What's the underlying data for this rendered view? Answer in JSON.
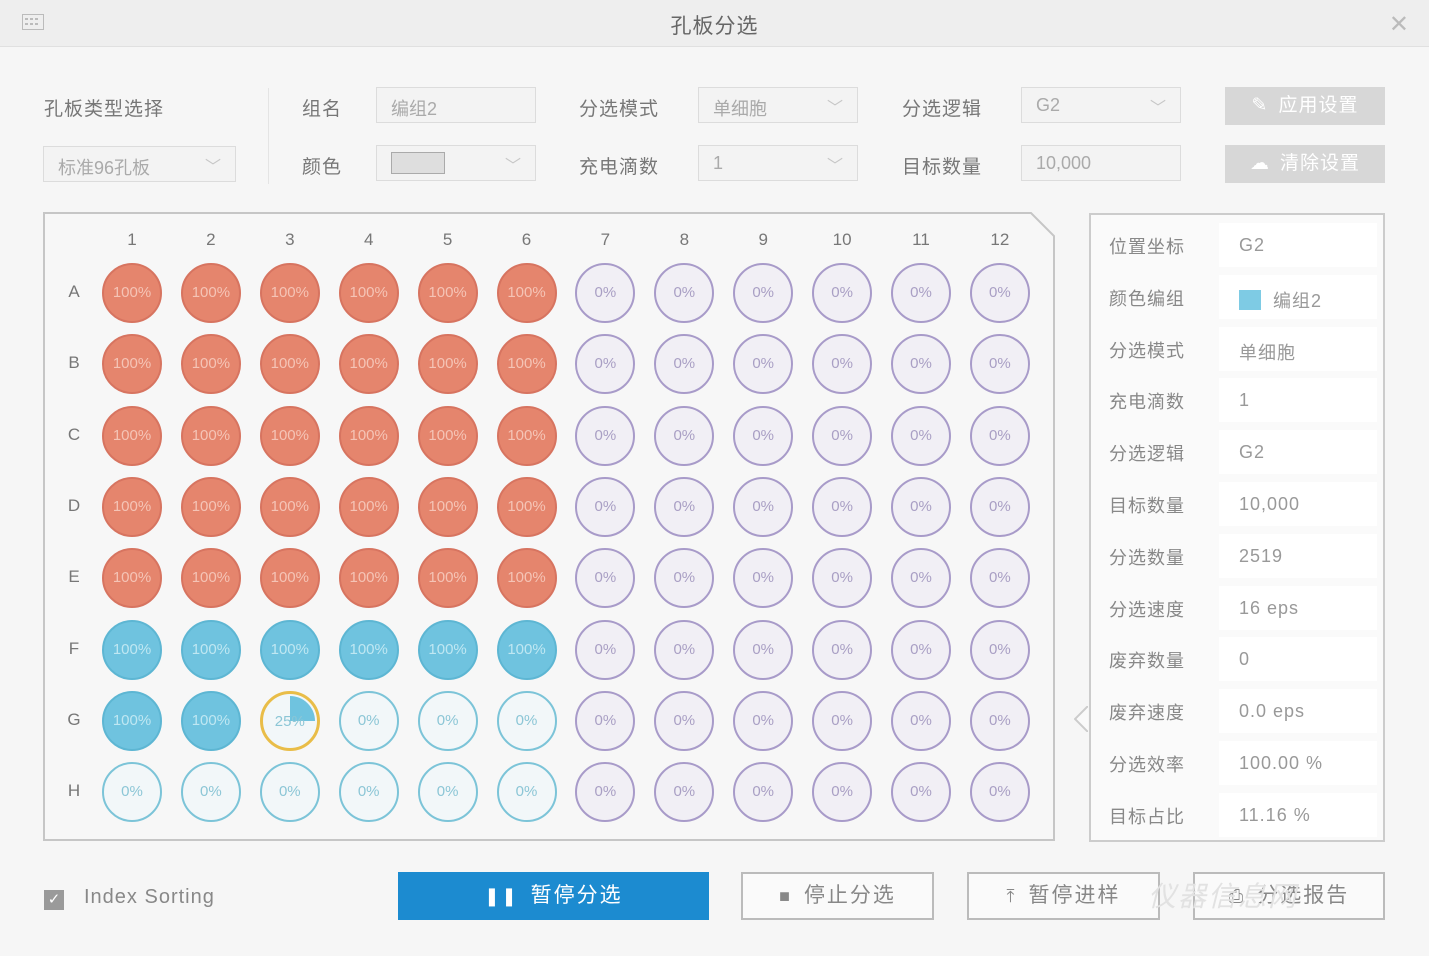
{
  "window": {
    "title": "孔板分选"
  },
  "settings": {
    "plate_type": {
      "label": "孔板类型选择",
      "value": "标准96孔板"
    },
    "group_name": {
      "label": "组名",
      "value": "编组2"
    },
    "color": {
      "label": "颜色"
    },
    "sort_mode": {
      "label": "分选模式",
      "value": "单细胞"
    },
    "charge_drops": {
      "label": "充电滴数",
      "value": "1"
    },
    "sort_logic": {
      "label": "分选逻辑",
      "value": "G2"
    },
    "target_count": {
      "label": "目标数量",
      "value": "10,000"
    },
    "apply_button": "应用设置",
    "clear_button": "清除设置"
  },
  "plate": {
    "columns": [
      "1",
      "2",
      "3",
      "4",
      "5",
      "6",
      "7",
      "8",
      "9",
      "10",
      "11",
      "12"
    ],
    "rows": [
      {
        "label": "A",
        "wells": [
          {
            "text": "100%",
            "state": "red"
          },
          {
            "text": "100%",
            "state": "red"
          },
          {
            "text": "100%",
            "state": "red"
          },
          {
            "text": "100%",
            "state": "red"
          },
          {
            "text": "100%",
            "state": "red"
          },
          {
            "text": "100%",
            "state": "red"
          },
          {
            "text": "0%",
            "state": "empty-p"
          },
          {
            "text": "0%",
            "state": "empty-p"
          },
          {
            "text": "0%",
            "state": "empty-p"
          },
          {
            "text": "0%",
            "state": "empty-p"
          },
          {
            "text": "0%",
            "state": "empty-p"
          },
          {
            "text": "0%",
            "state": "empty-p"
          }
        ]
      },
      {
        "label": "B",
        "wells": [
          {
            "text": "100%",
            "state": "red"
          },
          {
            "text": "100%",
            "state": "red"
          },
          {
            "text": "100%",
            "state": "red"
          },
          {
            "text": "100%",
            "state": "red"
          },
          {
            "text": "100%",
            "state": "red"
          },
          {
            "text": "100%",
            "state": "red"
          },
          {
            "text": "0%",
            "state": "empty-p"
          },
          {
            "text": "0%",
            "state": "empty-p"
          },
          {
            "text": "0%",
            "state": "empty-p"
          },
          {
            "text": "0%",
            "state": "empty-p"
          },
          {
            "text": "0%",
            "state": "empty-p"
          },
          {
            "text": "0%",
            "state": "empty-p"
          }
        ]
      },
      {
        "label": "C",
        "wells": [
          {
            "text": "100%",
            "state": "red"
          },
          {
            "text": "100%",
            "state": "red"
          },
          {
            "text": "100%",
            "state": "red"
          },
          {
            "text": "100%",
            "state": "red"
          },
          {
            "text": "100%",
            "state": "red"
          },
          {
            "text": "100%",
            "state": "red"
          },
          {
            "text": "0%",
            "state": "empty-p"
          },
          {
            "text": "0%",
            "state": "empty-p"
          },
          {
            "text": "0%",
            "state": "empty-p"
          },
          {
            "text": "0%",
            "state": "empty-p"
          },
          {
            "text": "0%",
            "state": "empty-p"
          },
          {
            "text": "0%",
            "state": "empty-p"
          }
        ]
      },
      {
        "label": "D",
        "wells": [
          {
            "text": "100%",
            "state": "red"
          },
          {
            "text": "100%",
            "state": "red"
          },
          {
            "text": "100%",
            "state": "red"
          },
          {
            "text": "100%",
            "state": "red"
          },
          {
            "text": "100%",
            "state": "red"
          },
          {
            "text": "100%",
            "state": "red"
          },
          {
            "text": "0%",
            "state": "empty-p"
          },
          {
            "text": "0%",
            "state": "empty-p"
          },
          {
            "text": "0%",
            "state": "empty-p"
          },
          {
            "text": "0%",
            "state": "empty-p"
          },
          {
            "text": "0%",
            "state": "empty-p"
          },
          {
            "text": "0%",
            "state": "empty-p"
          }
        ]
      },
      {
        "label": "E",
        "wells": [
          {
            "text": "100%",
            "state": "red"
          },
          {
            "text": "100%",
            "state": "red"
          },
          {
            "text": "100%",
            "state": "red"
          },
          {
            "text": "100%",
            "state": "red"
          },
          {
            "text": "100%",
            "state": "red"
          },
          {
            "text": "100%",
            "state": "red"
          },
          {
            "text": "0%",
            "state": "empty-p"
          },
          {
            "text": "0%",
            "state": "empty-p"
          },
          {
            "text": "0%",
            "state": "empty-p"
          },
          {
            "text": "0%",
            "state": "empty-p"
          },
          {
            "text": "0%",
            "state": "empty-p"
          },
          {
            "text": "0%",
            "state": "empty-p"
          }
        ]
      },
      {
        "label": "F",
        "wells": [
          {
            "text": "100%",
            "state": "blue"
          },
          {
            "text": "100%",
            "state": "blue"
          },
          {
            "text": "100%",
            "state": "blue"
          },
          {
            "text": "100%",
            "state": "blue"
          },
          {
            "text": "100%",
            "state": "blue"
          },
          {
            "text": "100%",
            "state": "blue"
          },
          {
            "text": "0%",
            "state": "empty-p"
          },
          {
            "text": "0%",
            "state": "empty-p"
          },
          {
            "text": "0%",
            "state": "empty-p"
          },
          {
            "text": "0%",
            "state": "empty-p"
          },
          {
            "text": "0%",
            "state": "empty-p"
          },
          {
            "text": "0%",
            "state": "empty-p"
          }
        ]
      },
      {
        "label": "G",
        "wells": [
          {
            "text": "100%",
            "state": "blue"
          },
          {
            "text": "100%",
            "state": "blue"
          },
          {
            "text": "25%",
            "state": "partial"
          },
          {
            "text": "0%",
            "state": "empty-b"
          },
          {
            "text": "0%",
            "state": "empty-b"
          },
          {
            "text": "0%",
            "state": "empty-b"
          },
          {
            "text": "0%",
            "state": "empty-p"
          },
          {
            "text": "0%",
            "state": "empty-p"
          },
          {
            "text": "0%",
            "state": "empty-p"
          },
          {
            "text": "0%",
            "state": "empty-p"
          },
          {
            "text": "0%",
            "state": "empty-p"
          },
          {
            "text": "0%",
            "state": "empty-p"
          }
        ]
      },
      {
        "label": "H",
        "wells": [
          {
            "text": "0%",
            "state": "empty-b"
          },
          {
            "text": "0%",
            "state": "empty-b"
          },
          {
            "text": "0%",
            "state": "empty-b"
          },
          {
            "text": "0%",
            "state": "empty-b"
          },
          {
            "text": "0%",
            "state": "empty-b"
          },
          {
            "text": "0%",
            "state": "empty-b"
          },
          {
            "text": "0%",
            "state": "empty-p"
          },
          {
            "text": "0%",
            "state": "empty-p"
          },
          {
            "text": "0%",
            "state": "empty-p"
          },
          {
            "text": "0%",
            "state": "empty-p"
          },
          {
            "text": "0%",
            "state": "empty-p"
          },
          {
            "text": "0%",
            "state": "empty-p"
          }
        ]
      }
    ]
  },
  "info_panel": [
    {
      "key": "位置坐标",
      "value": "G2"
    },
    {
      "key": "颜色编组",
      "value": "编组2",
      "swatch": "#7ecbe4"
    },
    {
      "key": "分选模式",
      "value": "单细胞"
    },
    {
      "key": "充电滴数",
      "value": "1"
    },
    {
      "key": "分选逻辑",
      "value": "G2"
    },
    {
      "key": "目标数量",
      "value": "10,000"
    },
    {
      "key": "分选数量",
      "value": "2519"
    },
    {
      "key": "分选速度",
      "value": "16 eps"
    },
    {
      "key": "废弃数量",
      "value": "0"
    },
    {
      "key": "废弃速度",
      "value": "0.0 eps"
    },
    {
      "key": "分选效率",
      "value": "100.00 %"
    },
    {
      "key": "目标占比",
      "value": "11.16 %"
    }
  ],
  "footer": {
    "index_sorting": {
      "label": "Index Sorting",
      "checked": true
    },
    "pause_sort": "暂停分选",
    "stop_sort": "停止分选",
    "pause_sample": "暂停进样",
    "sort_report": "分选报告"
  },
  "watermark": "仪器信息网",
  "colors": {
    "red": "#e5856d",
    "blue": "#6fc3df",
    "purple": "#a89bc9",
    "primary": "#1c8bd0",
    "highlight": "#e9bd48"
  },
  "icons": [
    "menu-icon",
    "close-icon",
    "pencil-icon",
    "cloud-icon",
    "pause-icon",
    "stop-icon",
    "upload-icon",
    "printer-icon",
    "check-icon"
  ]
}
